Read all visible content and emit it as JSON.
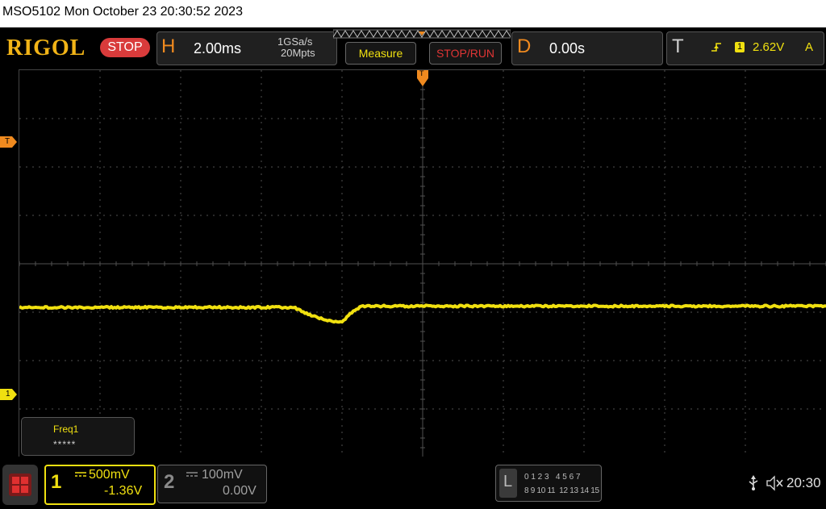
{
  "status": {
    "text": "MSO5102  Mon October 23 20:30:52 2023"
  },
  "header": {
    "logo": "RIGOL",
    "run_state": "STOP",
    "horizontal": {
      "letter": "H",
      "timebase": "2.00ms",
      "sample_rate": "1GSa/s",
      "memory_depth": "20Mpts"
    },
    "measure_button": "Measure",
    "stop_run_button": "STOP/RUN",
    "delay": {
      "letter": "D",
      "value": "0.00s"
    },
    "trigger": {
      "letter": "T",
      "source": "1",
      "level": "2.62V",
      "mode": "A"
    }
  },
  "plot": {
    "trigger_time_marker": "T",
    "trigger_level_marker": "T",
    "channel1_marker": "1",
    "trace_color": "#f0e010",
    "grid_color": "#505050"
  },
  "measure_box": {
    "label": "Freq1",
    "value": "*****"
  },
  "channels": [
    {
      "id": "1",
      "scale": "500mV",
      "offset": "-1.36V",
      "color": "#f0e010"
    },
    {
      "id": "2",
      "scale": "100mV",
      "offset": "0.00V",
      "color": "#8a8a8a"
    }
  ],
  "logic": {
    "letter": "L",
    "row1": "0 1 2 3   4 5 6 7",
    "row2": "8 9 10 11  12 13 14 15"
  },
  "footer": {
    "clock": "20:30"
  },
  "icons": [
    "usb-icon",
    "speaker-muted-icon",
    "menu-grid-icon",
    "trigger-edge-icon"
  ]
}
